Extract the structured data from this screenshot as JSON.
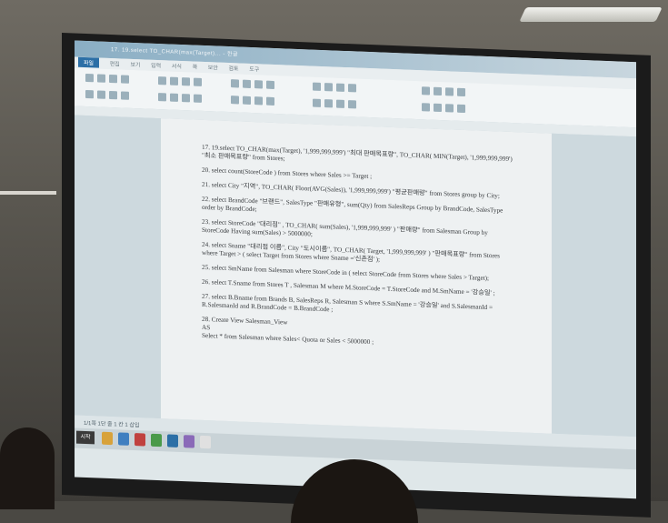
{
  "window": {
    "title": "17. 19.select TO_CHAR(max(Target)... - 한글",
    "file_tab": "파일",
    "menus": [
      "편집",
      "보기",
      "입력",
      "서식",
      "쪽",
      "보안",
      "검토",
      "도구"
    ]
  },
  "document": {
    "lines": [
      "17. 19.select TO_CHAR(max(Target), '1,999,999,999') \"최대 판매목표량\", TO_CHAR( MIN(Target), '1,999,999,999') \"최소 판매목표량\" from Stores;",
      "20. select count(StoreCode ) from Stores where Sales >= Target ;",
      "21. select City \"지역\", TO_CHAR( Floor(AVG(Sales)), '1,999,999,999') \"평균판매량\" from Stores group by City;",
      "22. select BrandCode \"브랜드\", SalesType \"판매유형\", sum(Qty) from SalesReps Group by BrandCode, SalesType order by BrandCode;",
      "23. select StoreCode \"대리점\" , TO_CHAR( sum(Sales), '1,999,999,999' ) \"판매량\" from Salesman Group by StoreCode Having sum(Sales) > 5000000;",
      "24. select Sname \"대리점 이름\", City \"도시이름\", TO_CHAR( Target, '1,999,999,999' ) \"판매목표량\" from Stores where Target > ( select Target from Stores where Sname ='신촌점' );",
      "25. select SmName from Salesman where StoreCode in ( select StoreCode from Stores where Sales > Target);",
      "26. select T.Sname from Stores T , Salesman M where M.StoreCode = T.StoreCode and M.SmName = '강승일' ;",
      "27. select B.Bname from Brands B, SalesReps R, Salesman S where S.SmName = '강승일' and S.SalesmanId = R.SalesmanId and R.BrandCode = B.BrandCode ;",
      "28. Create View Salesman_View",
      "AS",
      "Select * from Salesman where Sales< Quota or Sales < 5000000 ;"
    ]
  },
  "statusbar": {
    "text": "1/1쪽  1단  줄 1  칸 1  삽입"
  },
  "taskbar": {
    "start": "시작"
  },
  "colors": {
    "accent": "#2c6fa6",
    "page": "#eef1f2",
    "doc_bg": "#cdd9de"
  }
}
